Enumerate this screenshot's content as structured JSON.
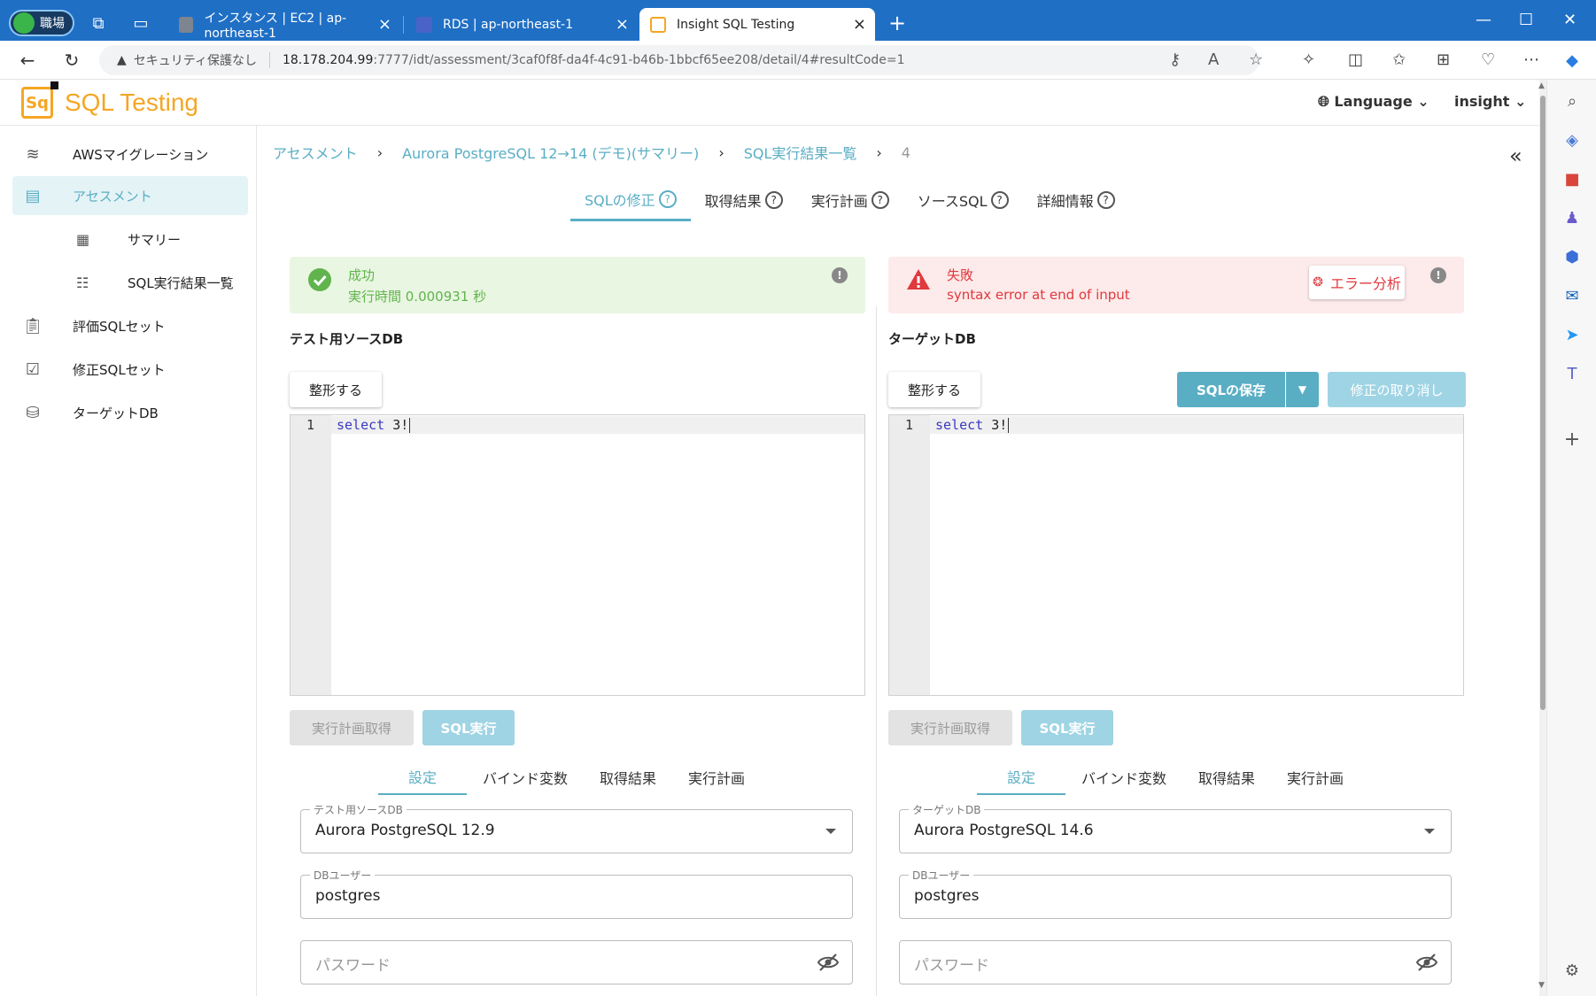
{
  "browser": {
    "profile_label": "職場",
    "tabs": [
      {
        "title": "インスタンス | EC2 | ap-northeast-1"
      },
      {
        "title": "RDS | ap-northeast-1"
      },
      {
        "title": "Insight SQL Testing"
      }
    ],
    "address": {
      "security": "セキュリティ保護なし",
      "host": "18.178.204.99",
      "path": ":7777/idt/assessment/3caf0f8f-da4f-4c91-b46b-1bbcf65ee208/detail/4#resultCode=1"
    }
  },
  "app": {
    "logo_text": "SQL Testing",
    "logo_mark": "Sq",
    "language_label": "Language",
    "user_label": "insight"
  },
  "sidebar": {
    "items": [
      {
        "label": "AWSマイグレーション",
        "icon": "database-migration-icon"
      },
      {
        "label": "アセスメント",
        "icon": "document-icon"
      },
      {
        "label": "評価SQLセット",
        "icon": "clipboard-icon"
      },
      {
        "label": "修正SQLセット",
        "icon": "clipboard-check-icon"
      },
      {
        "label": "ターゲットDB",
        "icon": "database-icon"
      }
    ],
    "sub_items": [
      {
        "label": "サマリー",
        "icon": "dashboard-icon"
      },
      {
        "label": "SQL実行結果一覧",
        "icon": "table-icon"
      }
    ]
  },
  "breadcrumb": {
    "items": [
      "アセスメント",
      "Aurora PostgreSQL 12→14 (デモ)(サマリー)",
      "SQL実行結果一覧"
    ],
    "current": "4"
  },
  "main_tabs": [
    "SQLの修正",
    "取得結果",
    "実行計画",
    "ソースSQL",
    "詳細情報"
  ],
  "source_panel": {
    "status_title": "成功",
    "status_sub": "実行時間 0.000931 秒",
    "db_title": "テスト用ソースDB",
    "format_label": "整形する",
    "line_number": "1",
    "code_keyword": "select",
    "code_rest": " 3!",
    "plan_label": "実行計画取得",
    "run_label": "SQL実行",
    "sub_tabs": [
      "設定",
      "バインド変数",
      "取得結果",
      "実行計画"
    ],
    "db_field_label": "テスト用ソースDB",
    "db_field_value": "Aurora PostgreSQL 12.9",
    "user_field_label": "DBユーザー",
    "user_field_value": "postgres",
    "password_placeholder": "パスワード"
  },
  "target_panel": {
    "status_title": "失敗",
    "status_sub": "syntax error at end of input",
    "error_button": "エラー分析",
    "db_title": "ターゲットDB",
    "format_label": "整形する",
    "save_label": "SQLの保存",
    "undo_label": "修正の取り消し",
    "line_number": "1",
    "code_keyword": "select",
    "code_rest": " 3!",
    "plan_label": "実行計画取得",
    "run_label": "SQL実行",
    "sub_tabs": [
      "設定",
      "バインド変数",
      "取得結果",
      "実行計画"
    ],
    "db_field_label": "ターゲットDB",
    "db_field_value": "Aurora PostgreSQL 14.6",
    "user_field_label": "DBユーザー",
    "user_field_value": "postgres",
    "password_placeholder": "パスワード"
  },
  "colors": {
    "accent": "#5aaec4",
    "success": "#61b44d",
    "error": "#e0393e",
    "logo": "#f5a623",
    "browser": "#1f6fc5"
  }
}
